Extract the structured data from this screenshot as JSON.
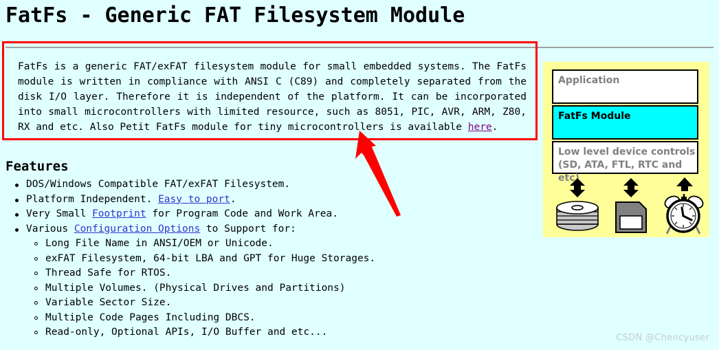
{
  "page": {
    "title": "FatFs - Generic FAT Filesystem Module",
    "background_color": "#e0ffff"
  },
  "intro": {
    "part1": "FatFs is a generic FAT/exFAT filesystem module for small embedded systems. The FatFs module is written in compliance with ANSI C (C89) and completely separated from the disk I/O layer. Therefore it is independent of the platform. It can be incorporated into small microcontrollers with limited resource, such as 8051, PIC, AVR, ARM, Z80, RX and etc. Also Petit FatFs module for tiny microcontrollers is available ",
    "link_here": "here",
    "part2": ".",
    "annotation_box_color": "#ff0000",
    "arrow_color": "#ff0000"
  },
  "features": {
    "heading": "Features",
    "items": [
      {
        "text_before": "DOS/Windows Compatible FAT/exFAT Filesystem.",
        "link": "",
        "text_after": ""
      },
      {
        "text_before": "Platform Independent. ",
        "link": "Easy to port",
        "text_after": "."
      },
      {
        "text_before": "Very Small ",
        "link": "Footprint",
        "text_after": " for Program Code and Work Area."
      },
      {
        "text_before": "Various ",
        "link": "Configuration Options",
        "text_after": " to Support for:"
      }
    ],
    "sub_items": [
      "Long File Name in ANSI/OEM or Unicode.",
      "exFAT Filesystem, 64-bit LBA and GPT for Huge Storages.",
      "Thread Safe for RTOS.",
      "Multiple Volumes. (Physical Drives and Partitions)",
      "Variable Sector Size.",
      "Multiple Code Pages Including DBCS.",
      "Read-only, Optional APIs, I/O Buffer and etc..."
    ],
    "link_color": "#3333cc",
    "visited_link_color": "#800080"
  },
  "diagram": {
    "panel_color": "#ffff99",
    "layers": [
      {
        "label": "Application",
        "fill": "#ffffff",
        "text_color": "#808080"
      },
      {
        "label": "FatFs Module",
        "fill": "#00ffff",
        "text_color": "#000000"
      },
      {
        "label": "Low level device controls\n(SD, ATA, FTL, RTC and etc)",
        "fill": "#ffffff",
        "text_color": "#808080"
      }
    ],
    "devices": [
      {
        "name": "disk-stack-icon",
        "arrow": "double"
      },
      {
        "name": "sd-card-icon",
        "arrow": "double"
      },
      {
        "name": "clock-icon",
        "arrow": "up"
      }
    ]
  },
  "watermark": {
    "text": "CSDN @Chencyuser"
  }
}
